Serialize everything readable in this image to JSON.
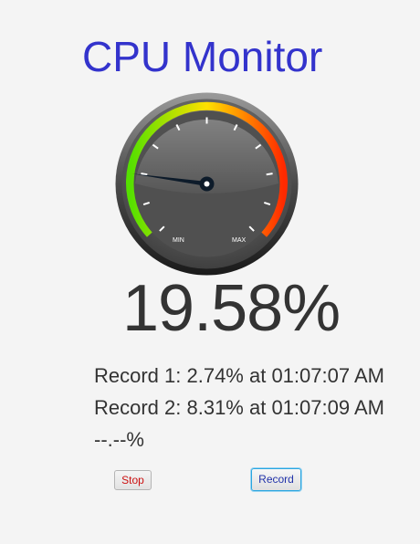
{
  "app": {
    "title": "CPU Monitor"
  },
  "gauge": {
    "min_label": "MIN",
    "max_label": "MAX",
    "needle_fraction": 0.1958,
    "colors": {
      "low": "#55e000",
      "mid": "#ffe000",
      "high": "#ff2a00",
      "dial": "#555555",
      "needle": "#0d1b2a"
    }
  },
  "readout": {
    "current": "19.58%"
  },
  "records": [
    {
      "text": "Record 1: 2.74% at 01:07:07 AM"
    },
    {
      "text": "Record 2: 8.31% at 01:07:09 AM"
    },
    {
      "text": "--.--%"
    }
  ],
  "buttons": {
    "stop_label": "Stop",
    "record_label": "Record"
  }
}
